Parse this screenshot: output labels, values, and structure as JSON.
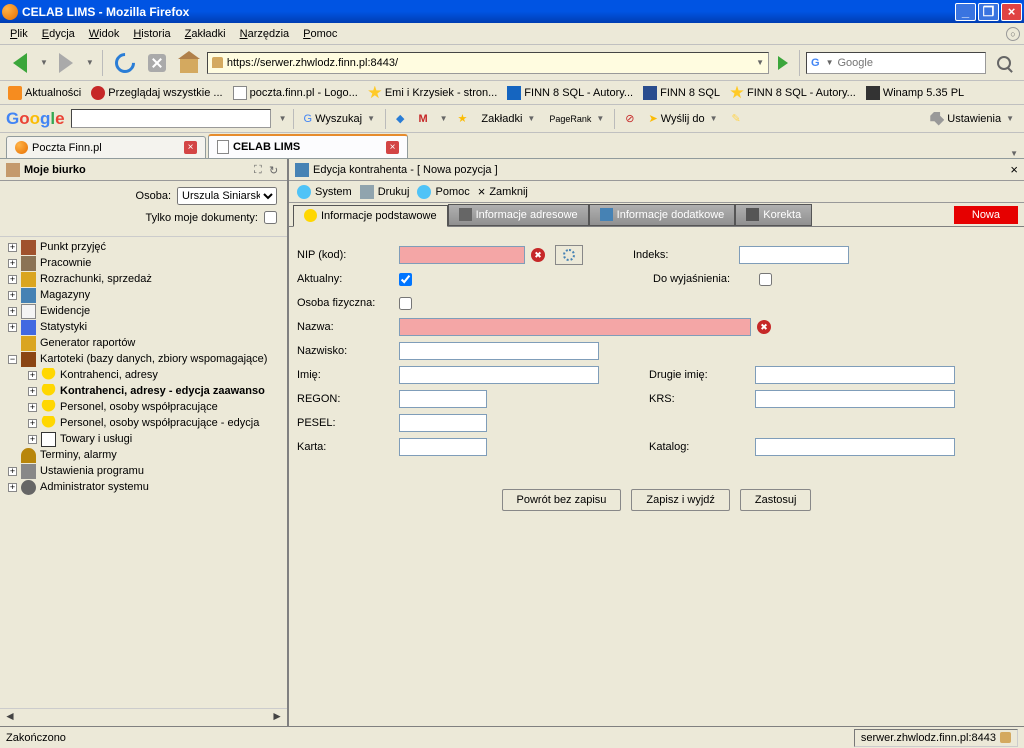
{
  "window": {
    "title": "CELAB LIMS - Mozilla Firefox"
  },
  "menubar": [
    "Plik",
    "Edycja",
    "Widok",
    "Historia",
    "Zakładki",
    "Narzędzia",
    "Pomoc"
  ],
  "nav": {
    "url": "https://serwer.zhwlodz.finn.pl:8443/",
    "search_placeholder": "Google"
  },
  "bookmarks": [
    {
      "label": "Aktualności",
      "icon": "rss"
    },
    {
      "label": "Przeglądaj wszystkie ...",
      "icon": "devil"
    },
    {
      "label": "poczta.finn.pl - Logo...",
      "icon": "mail"
    },
    {
      "label": "Emi i Krzysiek - stron...",
      "icon": "star-i"
    },
    {
      "label": "FINN 8 SQL - Autory...",
      "icon": "bank"
    },
    {
      "label": "FINN 8 SQL",
      "icon": "finn"
    },
    {
      "label": "FINN 8 SQL - Autory...",
      "icon": "star-i"
    },
    {
      "label": "Winamp 5.35 PL",
      "icon": "wamp"
    }
  ],
  "gtoolbar": {
    "search_btn": "Wyszukaj",
    "bookmarks": "Zakładki",
    "pagerank": "PageRank",
    "send": "Wyślij do",
    "settings": "Ustawienia"
  },
  "pagetabs": [
    {
      "label": "Poczta Finn.pl",
      "active": false
    },
    {
      "label": "CELAB LIMS",
      "active": true
    }
  ],
  "sidebar": {
    "title": "Moje biurko",
    "osoba_label": "Osoba:",
    "osoba_value": "Urszula Siniarska",
    "mydocs_label": "Tylko moje dokumenty:",
    "tree": [
      {
        "label": "Punkt przyjęć",
        "icon": "ic-door",
        "level": 1,
        "plus": "+"
      },
      {
        "label": "Pracownie",
        "icon": "ic-house",
        "level": 1,
        "plus": "+"
      },
      {
        "label": "Rozrachunki, sprzedaż",
        "icon": "ic-money",
        "level": 1,
        "plus": "+"
      },
      {
        "label": "Magazyny",
        "icon": "ic-box",
        "level": 1,
        "plus": "+"
      },
      {
        "label": "Ewidencje",
        "icon": "ic-doc",
        "level": 1,
        "plus": "+"
      },
      {
        "label": "Statystyki",
        "icon": "ic-chart",
        "level": 1,
        "plus": "+"
      },
      {
        "label": "Generator raportów",
        "icon": "ic-report",
        "level": 1,
        "plus": ""
      },
      {
        "label": "Kartoteki (bazy danych, zbiory wspomagające)",
        "icon": "ic-book",
        "level": 1,
        "plus": "−"
      },
      {
        "label": "Kontrahenci, adresy",
        "icon": "ic-man",
        "level": 2,
        "plus": "+"
      },
      {
        "label": "Kontrahenci, adresy - edycja zaawanso",
        "icon": "ic-man",
        "level": 2,
        "plus": "+",
        "bold": true
      },
      {
        "label": "Personel, osoby współpracujące",
        "icon": "ic-man",
        "level": 2,
        "plus": "+"
      },
      {
        "label": "Personel, osoby współpracujące - edycja",
        "icon": "ic-man",
        "level": 2,
        "plus": "+"
      },
      {
        "label": "Towary i usługi",
        "icon": "ic-card",
        "level": 2,
        "plus": "+"
      },
      {
        "label": "Terminy, alarmy",
        "icon": "ic-bell",
        "level": 1,
        "plus": ""
      },
      {
        "label": "Ustawienia programu",
        "icon": "ic-tools",
        "level": 1,
        "plus": "+"
      },
      {
        "label": "Administrator systemu",
        "icon": "ic-gear",
        "level": 1,
        "plus": "+"
      }
    ]
  },
  "main": {
    "title": "Edycja kontrahenta - [ Nowa pozycja ]",
    "toolbar": [
      {
        "label": "System",
        "icon": "ii-sys"
      },
      {
        "label": "Drukuj",
        "icon": "ii-print"
      },
      {
        "label": "Pomoc",
        "icon": "ii-help"
      },
      {
        "label": "Zamknij",
        "icon": "ii-close",
        "glyph": "×"
      }
    ],
    "tabs": [
      {
        "label": "Informacje podstawowe",
        "icon": "ti-info",
        "active": true
      },
      {
        "label": "Informacje adresowe",
        "icon": "ti-addr"
      },
      {
        "label": "Informacje dodatkowe",
        "icon": "ti-extra"
      },
      {
        "label": "Korekta",
        "icon": "ti-kor"
      }
    ],
    "new_label": "Nowa",
    "form": {
      "nip": "NIP (kod):",
      "aktualny": "Aktualny:",
      "osoba_fiz": "Osoba fizyczna:",
      "nazwa": "Nazwa:",
      "nazwisko": "Nazwisko:",
      "imie": "Imię:",
      "regon": "REGON:",
      "pesel": "PESEL:",
      "karta": "Karta:",
      "indeks": "Indeks:",
      "doWyj": "Do wyjaśnienia:",
      "drugie": "Drugie imię:",
      "krs": "KRS:",
      "katalog": "Katalog:"
    },
    "buttons": {
      "cancel": "Powrót bez zapisu",
      "save_exit": "Zapisz i wyjdź",
      "apply": "Zastosuj"
    }
  },
  "status": {
    "left": "Zakończono",
    "right": "serwer.zhwlodz.finn.pl:8443"
  }
}
